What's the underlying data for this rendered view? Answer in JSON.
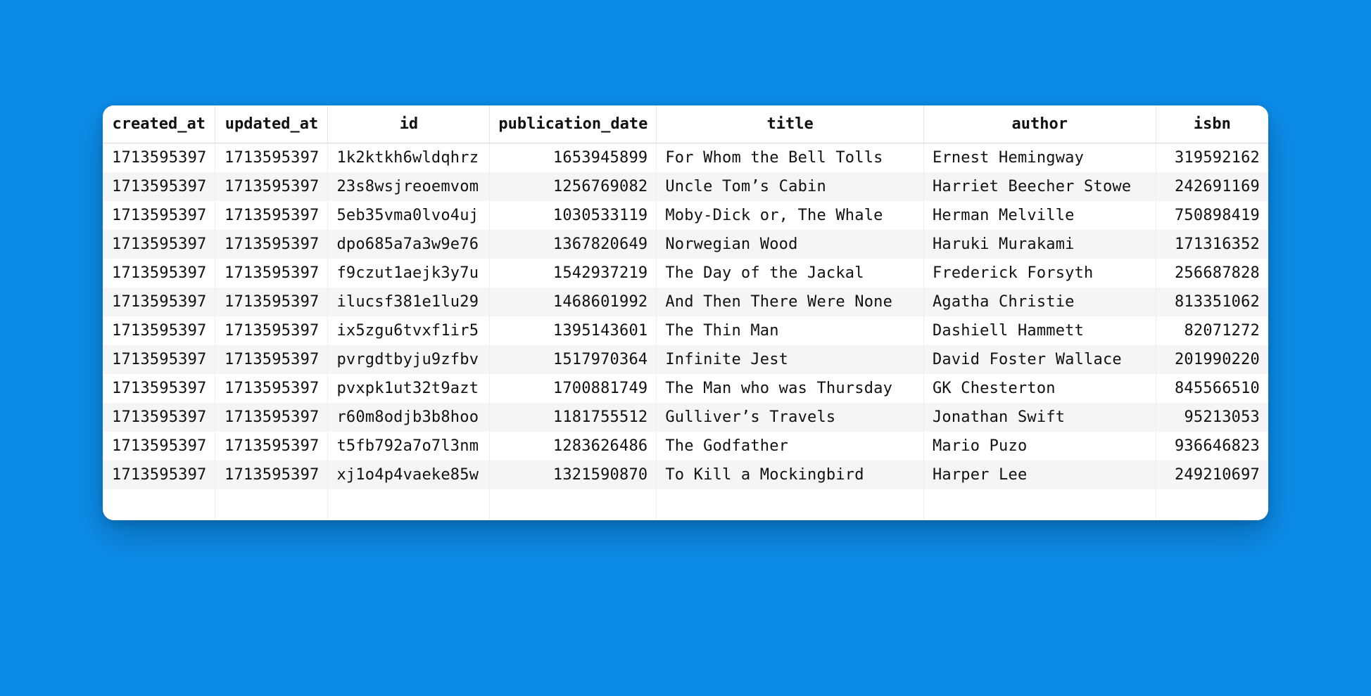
{
  "table": {
    "columns": [
      {
        "key": "created_at",
        "label": "created_at",
        "align": "num"
      },
      {
        "key": "updated_at",
        "label": "updated_at",
        "align": "num"
      },
      {
        "key": "id",
        "label": "id",
        "align": "txt"
      },
      {
        "key": "publication_date",
        "label": "publication_date",
        "align": "num"
      },
      {
        "key": "title",
        "label": "title",
        "align": "txt"
      },
      {
        "key": "author",
        "label": "author",
        "align": "txt"
      },
      {
        "key": "isbn",
        "label": "isbn",
        "align": "num"
      }
    ],
    "rows": [
      {
        "created_at": "1713595397",
        "updated_at": "1713595397",
        "id": "1k2ktkh6wldqhrz",
        "publication_date": "1653945899",
        "title": "For Whom the Bell Tolls",
        "author": "Ernest Hemingway",
        "isbn": "319592162"
      },
      {
        "created_at": "1713595397",
        "updated_at": "1713595397",
        "id": "23s8wsjreoemvom",
        "publication_date": "1256769082",
        "title": "Uncle Tom’s Cabin",
        "author": "Harriet Beecher Stowe",
        "isbn": "242691169"
      },
      {
        "created_at": "1713595397",
        "updated_at": "1713595397",
        "id": "5eb35vma0lvo4uj",
        "publication_date": "1030533119",
        "title": "Moby-Dick or, The Whale",
        "author": "Herman Melville",
        "isbn": "750898419"
      },
      {
        "created_at": "1713595397",
        "updated_at": "1713595397",
        "id": "dpo685a7a3w9e76",
        "publication_date": "1367820649",
        "title": "Norwegian Wood",
        "author": "Haruki Murakami",
        "isbn": "171316352"
      },
      {
        "created_at": "1713595397",
        "updated_at": "1713595397",
        "id": "f9czut1aejk3y7u",
        "publication_date": "1542937219",
        "title": "The Day of the Jackal",
        "author": "Frederick Forsyth",
        "isbn": "256687828"
      },
      {
        "created_at": "1713595397",
        "updated_at": "1713595397",
        "id": "ilucsf381e1lu29",
        "publication_date": "1468601992",
        "title": "And Then There Were None",
        "author": "Agatha Christie",
        "isbn": "813351062"
      },
      {
        "created_at": "1713595397",
        "updated_at": "1713595397",
        "id": "ix5zgu6tvxf1ir5",
        "publication_date": "1395143601",
        "title": "The Thin Man",
        "author": "Dashiell Hammett",
        "isbn": "82071272"
      },
      {
        "created_at": "1713595397",
        "updated_at": "1713595397",
        "id": "pvrgdtbyju9zfbv",
        "publication_date": "1517970364",
        "title": "Infinite Jest",
        "author": "David Foster Wallace",
        "isbn": "201990220"
      },
      {
        "created_at": "1713595397",
        "updated_at": "1713595397",
        "id": "pvxpk1ut32t9azt",
        "publication_date": "1700881749",
        "title": "The Man who was Thursday",
        "author": "GK Chesterton",
        "isbn": "845566510"
      },
      {
        "created_at": "1713595397",
        "updated_at": "1713595397",
        "id": "r60m8odjb3b8hoo",
        "publication_date": "1181755512",
        "title": "Gulliver’s Travels",
        "author": "Jonathan Swift",
        "isbn": "95213053"
      },
      {
        "created_at": "1713595397",
        "updated_at": "1713595397",
        "id": "t5fb792a7o7l3nm",
        "publication_date": "1283626486",
        "title": "The Godfather",
        "author": "Mario Puzo",
        "isbn": "936646823"
      },
      {
        "created_at": "1713595397",
        "updated_at": "1713595397",
        "id": "xj1o4p4vaeke85w",
        "publication_date": "1321590870",
        "title": "To Kill a Mockingbird",
        "author": "Harper Lee",
        "isbn": "249210697"
      }
    ]
  }
}
